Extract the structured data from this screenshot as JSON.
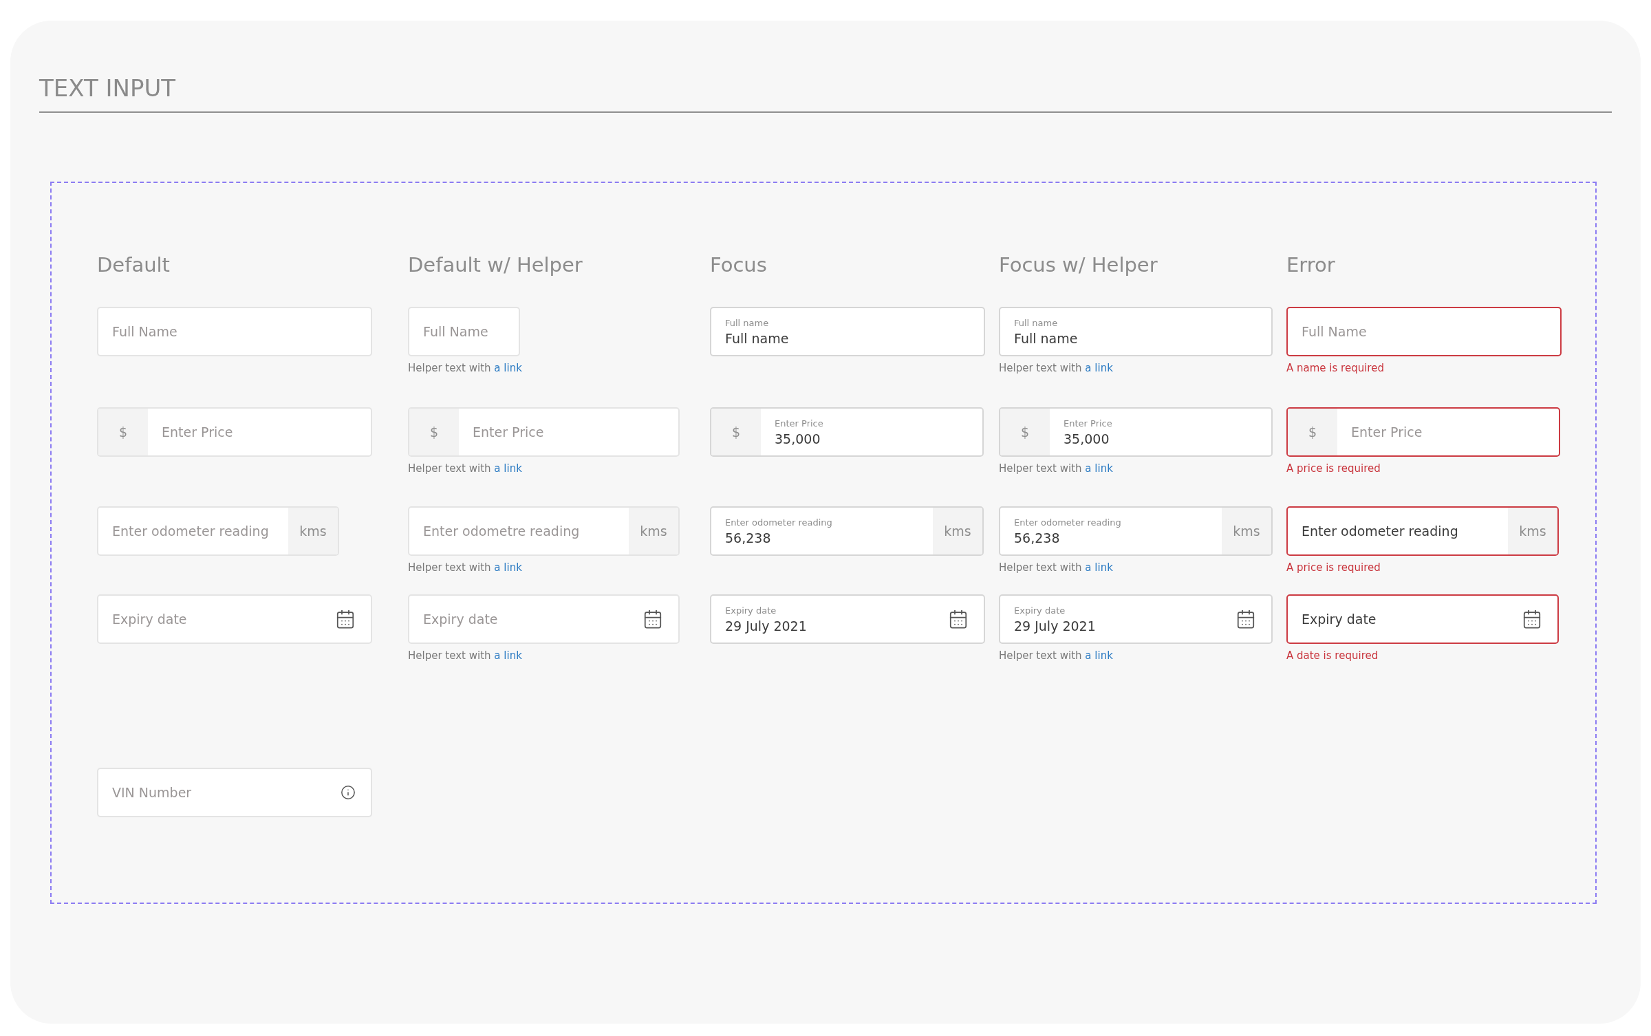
{
  "title": "TEXT INPUT",
  "columns": [
    {
      "heading": "Default",
      "focused": false,
      "invalid": false,
      "fields": [
        {
          "kind": "text",
          "placeholder": "Full Name"
        },
        {
          "kind": "prefix",
          "prefix": "$",
          "placeholder": "Enter Price"
        },
        {
          "kind": "suffix",
          "suffix": "kms",
          "placeholder": "Enter odometer reading"
        },
        {
          "kind": "date",
          "placeholder": "Expiry date"
        },
        {
          "kind": "info",
          "placeholder": "VIN Number"
        }
      ]
    },
    {
      "heading": "Default w/ Helper",
      "focused": false,
      "invalid": false,
      "fields": [
        {
          "kind": "text",
          "placeholder": "Full Name",
          "helper": {
            "text": "Helper text with",
            "link": "a link"
          }
        },
        {
          "kind": "prefix",
          "prefix": "$",
          "placeholder": "Enter Price",
          "helper": {
            "text": "Helper text with",
            "link": "a link"
          }
        },
        {
          "kind": "suffix",
          "suffix": "kms",
          "placeholder": "Enter odometre reading",
          "helper": {
            "text": "Helper text with",
            "link": "a link"
          }
        },
        {
          "kind": "date",
          "placeholder": "Expiry date",
          "helper": {
            "text": "Helper text with",
            "link": "a link"
          }
        }
      ]
    },
    {
      "heading": "Focus",
      "focused": true,
      "invalid": false,
      "fields": [
        {
          "kind": "text",
          "label": "Full name",
          "value": "Full name"
        },
        {
          "kind": "prefix",
          "prefix": "$",
          "label": "Enter Price",
          "value": "35,000"
        },
        {
          "kind": "suffix",
          "suffix": "kms",
          "label": "Enter odometer reading",
          "value": "56,238"
        },
        {
          "kind": "date",
          "label": "Expiry date",
          "value": "29 July 2021"
        }
      ]
    },
    {
      "heading": "Focus w/ Helper",
      "focused": true,
      "invalid": false,
      "fields": [
        {
          "kind": "text",
          "label": "Full name",
          "value": "Full name",
          "helper": {
            "text": "Helper text with",
            "link": "a link"
          }
        },
        {
          "kind": "prefix",
          "prefix": "$",
          "label": "Enter Price",
          "value": "35,000",
          "helper": {
            "text": "Helper text with",
            "link": "a link"
          }
        },
        {
          "kind": "suffix",
          "suffix": "kms",
          "label": "Enter odometer reading",
          "value": "56,238",
          "helper": {
            "text": "Helper text with",
            "link": "a link"
          }
        },
        {
          "kind": "date",
          "label": "Expiry date",
          "value": "29 July 2021",
          "helper": {
            "text": "Helper text with",
            "link": "a link"
          }
        }
      ]
    },
    {
      "heading": "Error",
      "focused": false,
      "invalid": true,
      "fields": [
        {
          "kind": "text",
          "placeholder": "Full Name",
          "error": "A name is required"
        },
        {
          "kind": "prefix",
          "prefix": "$",
          "placeholder": "Enter Price",
          "error": "A price is required"
        },
        {
          "kind": "suffix",
          "suffix": "kms",
          "value": "Enter odometer reading",
          "error": "A price is required"
        },
        {
          "kind": "date",
          "value": "Expiry date",
          "error": "A date is required"
        }
      ]
    }
  ]
}
